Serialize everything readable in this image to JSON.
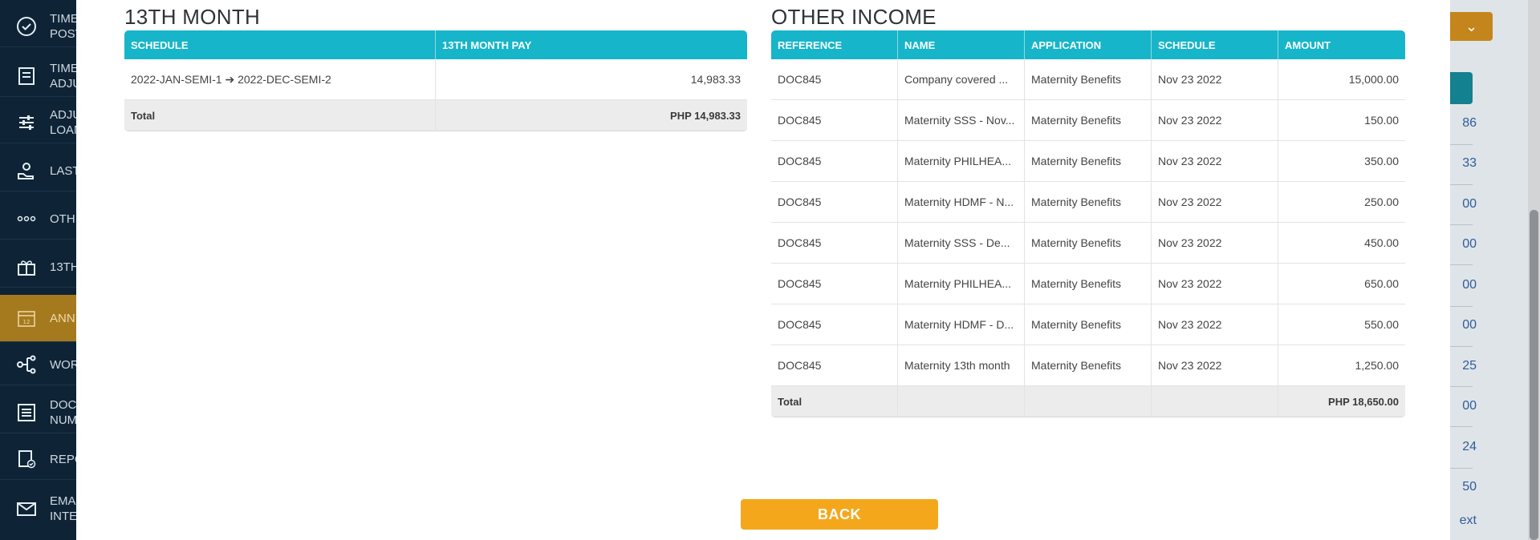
{
  "sidebar": {
    "items": [
      {
        "label": "TIME\nPOST",
        "icon": "check-circle-icon"
      },
      {
        "label": "TIME\nADJU",
        "icon": "timesheet-icon"
      },
      {
        "label": "ADJU\nLOAN",
        "icon": "sliders-icon"
      },
      {
        "label": "LAST",
        "icon": "hand-coin-icon"
      },
      {
        "label": "OTH",
        "icon": "ellipsis-icon"
      },
      {
        "label": "13TH",
        "icon": "gift-icon"
      },
      {
        "label": "ANN",
        "icon": "calendar-icon"
      },
      {
        "label": "WOR",
        "icon": "workflow-icon"
      },
      {
        "label": "DOC\nNUM",
        "icon": "document-list-icon"
      },
      {
        "label": "REPO",
        "icon": "report-icon"
      },
      {
        "label": "EMA\nINTE",
        "icon": "envelope-icon"
      }
    ]
  },
  "underlay": {
    "values": [
      "86",
      "33",
      "00",
      "00",
      "00",
      "00",
      "25",
      "00",
      "24",
      "50"
    ],
    "footer_link": "ext"
  },
  "thirteenth_month": {
    "title": "13TH MONTH",
    "columns": [
      "SCHEDULE",
      "13TH MONTH PAY"
    ],
    "rows": [
      {
        "schedule": "2022-JAN-SEMI-1 ➔ 2022-DEC-SEMI-2",
        "pay": "14,983.33"
      }
    ],
    "total_label": "Total",
    "total_value": "PHP 14,983.33"
  },
  "other_income": {
    "title": "OTHER INCOME",
    "columns": [
      "REFERENCE",
      "NAME",
      "APPLICATION",
      "SCHEDULE",
      "AMOUNT"
    ],
    "rows": [
      {
        "reference": "DOC845",
        "name": "Company covered ...",
        "application": "Maternity Benefits",
        "schedule": "Nov 23 2022",
        "amount": "15,000.00"
      },
      {
        "reference": "DOC845",
        "name": "Maternity SSS - Nov...",
        "application": "Maternity Benefits",
        "schedule": "Nov 23 2022",
        "amount": "150.00"
      },
      {
        "reference": "DOC845",
        "name": "Maternity PHILHEA...",
        "application": "Maternity Benefits",
        "schedule": "Nov 23 2022",
        "amount": "350.00"
      },
      {
        "reference": "DOC845",
        "name": "Maternity HDMF - N...",
        "application": "Maternity Benefits",
        "schedule": "Nov 23 2022",
        "amount": "250.00"
      },
      {
        "reference": "DOC845",
        "name": "Maternity SSS - De...",
        "application": "Maternity Benefits",
        "schedule": "Nov 23 2022",
        "amount": "450.00"
      },
      {
        "reference": "DOC845",
        "name": "Maternity PHILHEA...",
        "application": "Maternity Benefits",
        "schedule": "Nov 23 2022",
        "amount": "650.00"
      },
      {
        "reference": "DOC845",
        "name": "Maternity HDMF - D...",
        "application": "Maternity Benefits",
        "schedule": "Nov 23 2022",
        "amount": "550.00"
      },
      {
        "reference": "DOC845",
        "name": "Maternity 13th month",
        "application": "Maternity Benefits",
        "schedule": "Nov 23 2022",
        "amount": "1,250.00"
      }
    ],
    "total_label": "Total",
    "total_value": "PHP 18,650.00"
  },
  "back_button": "BACK",
  "colors": {
    "header_teal": "#17b5c9",
    "button_orange": "#f5a71c",
    "sidebar_bg": "#0e2436",
    "sidebar_active": "#a57a1f"
  }
}
